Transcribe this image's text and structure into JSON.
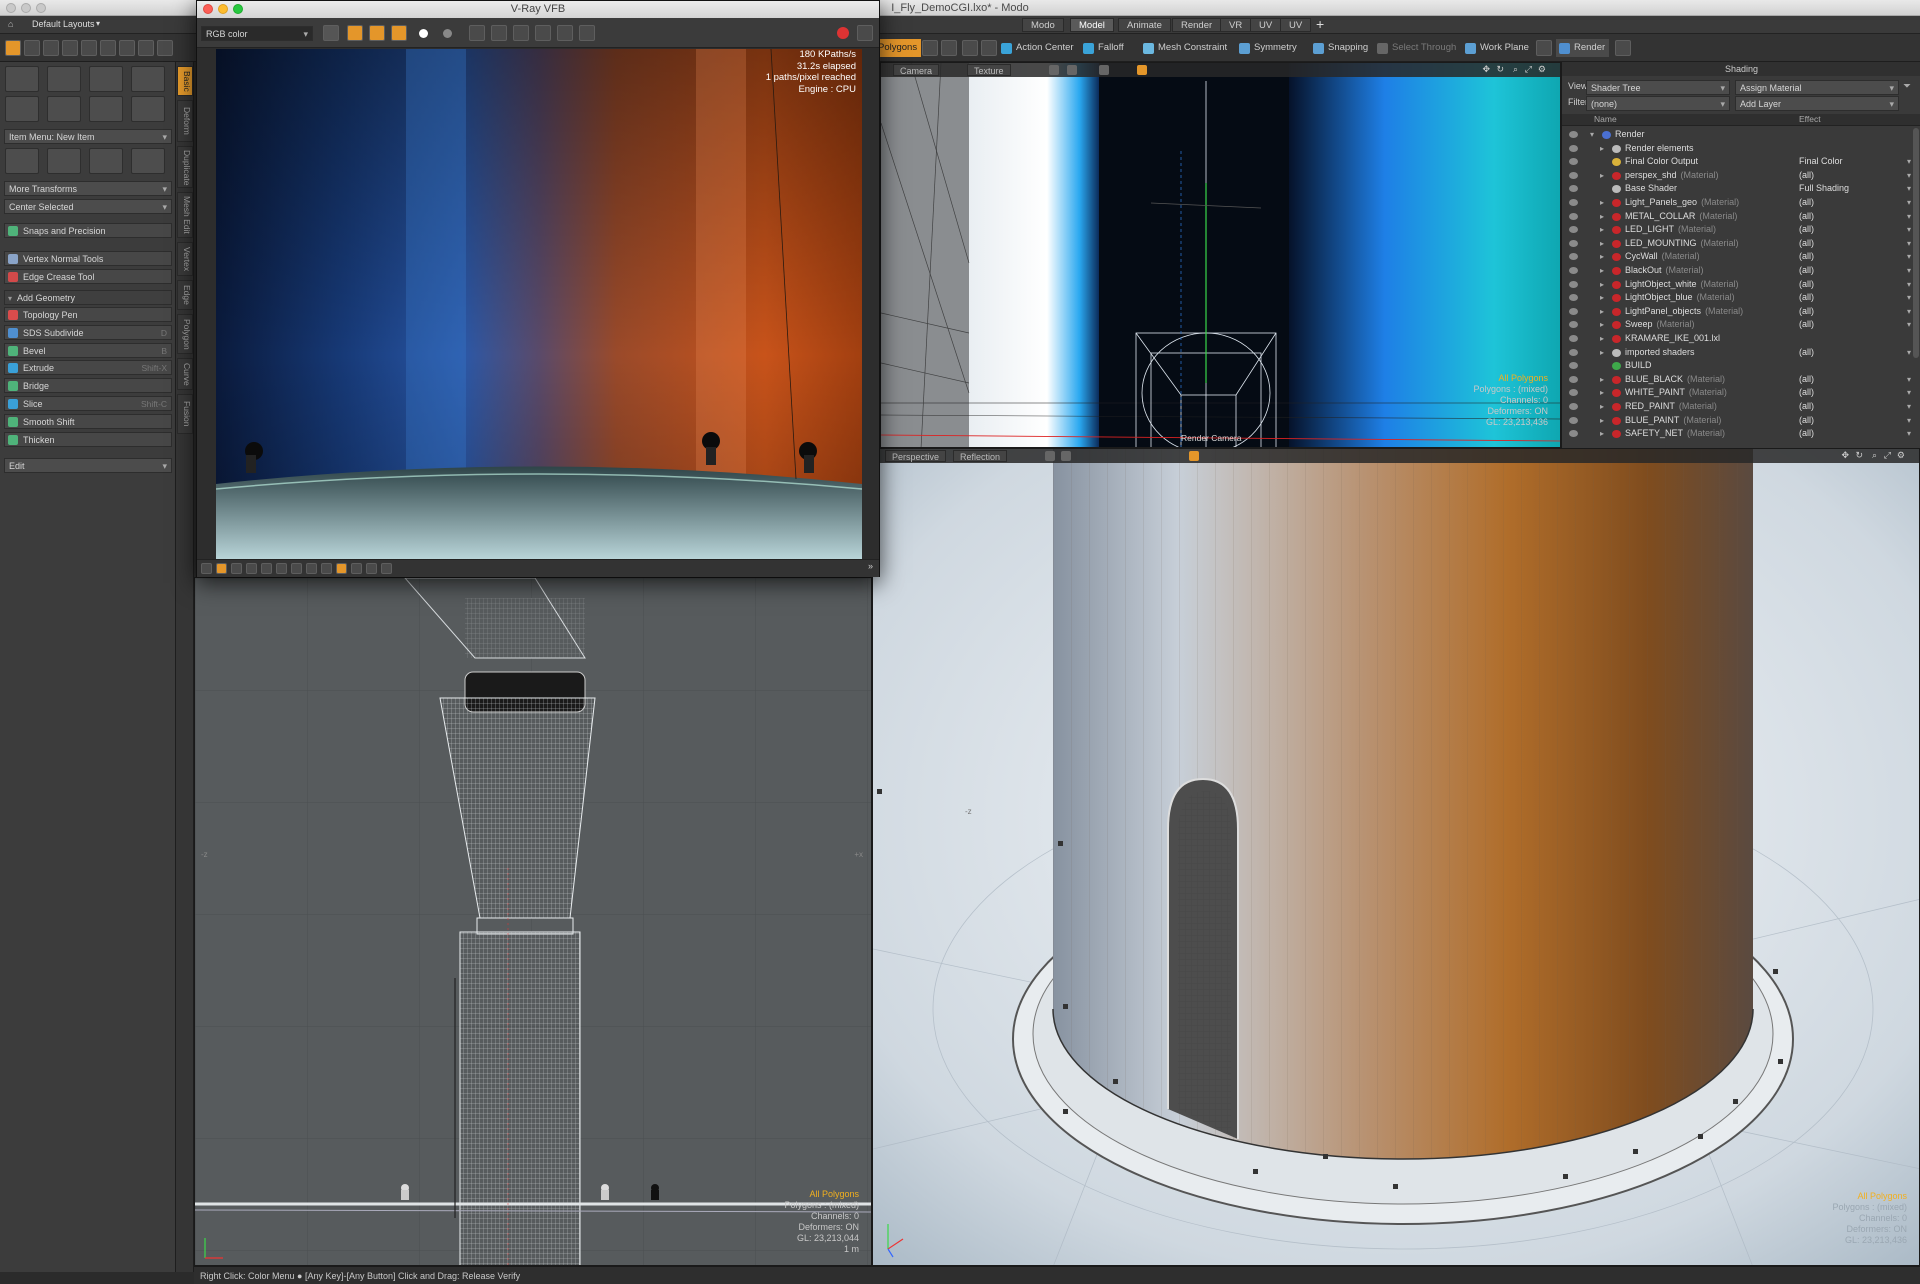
{
  "window": {
    "title": "I_Fly_DemoCGI.lxo* - Modo",
    "layout_label": "Default Layouts"
  },
  "menu_tabs": [
    {
      "label": "Modo",
      "active": false
    },
    {
      "label": "Model",
      "active": true
    },
    {
      "label": "Animate",
      "active": false
    },
    {
      "label": "Render",
      "active": false
    },
    {
      "label": "VR",
      "active": false
    },
    {
      "label": "UV",
      "active": false
    },
    {
      "label": "UV",
      "active": false
    }
  ],
  "add_tab_label": "+",
  "toolbar": {
    "polygons": "Polygons",
    "action_center": "Action Center",
    "falloff": "Falloff",
    "mesh_constraint": "Mesh Constraint",
    "symmetry": "Symmetry",
    "snapping": "Snapping",
    "select_through": "Select Through",
    "work_plane": "Work Plane",
    "render": "Render"
  },
  "left_panel": {
    "item_menu": "Item Menu: New Item",
    "more_transforms": "More Transforms",
    "center_selected": "Center Selected",
    "snaps_and_precision": "Snaps and Precision",
    "vertex_normal_tools": "Vertex Normal Tools",
    "edge_crease_tool": "Edge Crease Tool",
    "add_geometry": "Add Geometry",
    "tools": [
      {
        "label": "Topology Pen",
        "shortcut": ""
      },
      {
        "label": "SDS Subdivide",
        "shortcut": "D"
      },
      {
        "label": "Bevel",
        "shortcut": "B"
      },
      {
        "label": "Extrude",
        "shortcut": "Shift-X"
      },
      {
        "label": "Bridge",
        "shortcut": ""
      },
      {
        "label": "Slice",
        "shortcut": "Shift-C"
      },
      {
        "label": "Smooth Shift",
        "shortcut": ""
      },
      {
        "label": "Thicken",
        "shortcut": ""
      }
    ],
    "edit": "Edit"
  },
  "vertical_tabs": [
    "Basic",
    "Deform",
    "Duplicate",
    "Mesh Edit",
    "Vertex",
    "Edge",
    "Polygon",
    "Curve",
    "Fusion"
  ],
  "vfb": {
    "title": "V-Ray VFB",
    "channel": "RGB color",
    "stats": [
      "180 KPaths/s",
      "31.2s elapsed",
      "1 paths/pixel reached",
      "Engine : CPU"
    ]
  },
  "viewport_top": {
    "camera_label": "Camera",
    "texture_label": "Texture",
    "info": [
      "All Polygons",
      "Polygons : (mixed)",
      "Channels: 0",
      "Deformers: ON",
      "GL: 23,213,436"
    ],
    "render_camera": "Render Camera"
  },
  "viewport_left": {
    "info": [
      "All Polygons",
      "Polygons : (mixed)",
      "Channels: 0",
      "Deformers: ON",
      "GL: 23,213,044",
      "1 m"
    ],
    "axis_z": "-z",
    "axis_x": "+x"
  },
  "viewport_persp": {
    "perspective_label": "Perspective",
    "reflection_label": "Reflection",
    "info": [
      "All Polygons",
      "Polygons : (mixed)",
      "Channels: 0",
      "Deformers: ON",
      "GL: 23,213,436"
    ],
    "axis_z": "-z"
  },
  "shading": {
    "title": "Shading",
    "view_label": "View",
    "view_value": "Shader Tree",
    "assign_material": "Assign Material",
    "filter_label": "Filter",
    "filter_value": "(none)",
    "add_layer": "Add Layer",
    "col_name": "Name",
    "col_effect": "Effect",
    "colors": {
      "red": "#c8262a",
      "yellow": "#d9b23a",
      "green": "#3ea84a",
      "grey": "#bbbbbb",
      "blue": "#4a6fd0"
    },
    "rows": [
      {
        "name": "Render",
        "tag": "",
        "effect": "",
        "indent": 0,
        "icon": "blue",
        "arrow": "▾"
      },
      {
        "name": "Render elements",
        "tag": "",
        "effect": "",
        "indent": 1,
        "icon": "grey",
        "arrow": "▸"
      },
      {
        "name": "Final Color Output",
        "tag": "",
        "effect": "Final Color",
        "indent": 1,
        "icon": "yellow",
        "arrow": ""
      },
      {
        "name": "perspex_shd",
        "tag": "(Material)",
        "effect": "(all)",
        "indent": 1,
        "icon": "red",
        "arrow": "▸"
      },
      {
        "name": "Base Shader",
        "tag": "",
        "effect": "Full Shading",
        "indent": 1,
        "icon": "grey",
        "arrow": ""
      },
      {
        "name": "Light_Panels_geo",
        "tag": "(Material)",
        "effect": "(all)",
        "indent": 1,
        "icon": "red",
        "arrow": "▸"
      },
      {
        "name": "METAL_COLLAR",
        "tag": "(Material)",
        "effect": "(all)",
        "indent": 1,
        "icon": "red",
        "arrow": "▸"
      },
      {
        "name": "LED_LIGHT",
        "tag": "(Material)",
        "effect": "(all)",
        "indent": 1,
        "icon": "red",
        "arrow": "▸"
      },
      {
        "name": "LED_MOUNTING",
        "tag": "(Material)",
        "effect": "(all)",
        "indent": 1,
        "icon": "red",
        "arrow": "▸"
      },
      {
        "name": "CycWall",
        "tag": "(Material)",
        "effect": "(all)",
        "indent": 1,
        "icon": "red",
        "arrow": "▸"
      },
      {
        "name": "BlackOut",
        "tag": "(Material)",
        "effect": "(all)",
        "indent": 1,
        "icon": "red",
        "arrow": "▸"
      },
      {
        "name": "LightObject_white",
        "tag": "(Material)",
        "effect": "(all)",
        "indent": 1,
        "icon": "red",
        "arrow": "▸"
      },
      {
        "name": "LightObject_blue",
        "tag": "(Material)",
        "effect": "(all)",
        "indent": 1,
        "icon": "red",
        "arrow": "▸"
      },
      {
        "name": "LightPanel_objects",
        "tag": "(Material)",
        "effect": "(all)",
        "indent": 1,
        "icon": "red",
        "arrow": "▸"
      },
      {
        "name": "Sweep",
        "tag": "(Material)",
        "effect": "(all)",
        "indent": 1,
        "icon": "red",
        "arrow": "▸"
      },
      {
        "name": "KRAMARE_IKE_001.lxl",
        "tag": "",
        "effect": "",
        "indent": 1,
        "icon": "red",
        "arrow": "▸"
      },
      {
        "name": "imported shaders",
        "tag": "",
        "effect": "(all)",
        "indent": 1,
        "icon": "grey",
        "arrow": "▸"
      },
      {
        "name": "BUILD",
        "tag": "",
        "effect": "",
        "indent": 1,
        "icon": "green",
        "arrow": ""
      },
      {
        "name": "BLUE_BLACK",
        "tag": "(Material)",
        "effect": "(all)",
        "indent": 1,
        "icon": "red",
        "arrow": "▸"
      },
      {
        "name": "WHITE_PAINT",
        "tag": "(Material)",
        "effect": "(all)",
        "indent": 1,
        "icon": "red",
        "arrow": "▸"
      },
      {
        "name": "RED_PAINT",
        "tag": "(Material)",
        "effect": "(all)",
        "indent": 1,
        "icon": "red",
        "arrow": "▸"
      },
      {
        "name": "BLUE_PAINT",
        "tag": "(Material)",
        "effect": "(all)",
        "indent": 1,
        "icon": "red",
        "arrow": "▸"
      },
      {
        "name": "SAFETY_NET",
        "tag": "(Material)",
        "effect": "(all)",
        "indent": 1,
        "icon": "red",
        "arrow": "▸"
      }
    ]
  },
  "status_bar": "Right Click: Color Menu ● [Any Key]-[Any Button] Click and Drag: Release Verify"
}
